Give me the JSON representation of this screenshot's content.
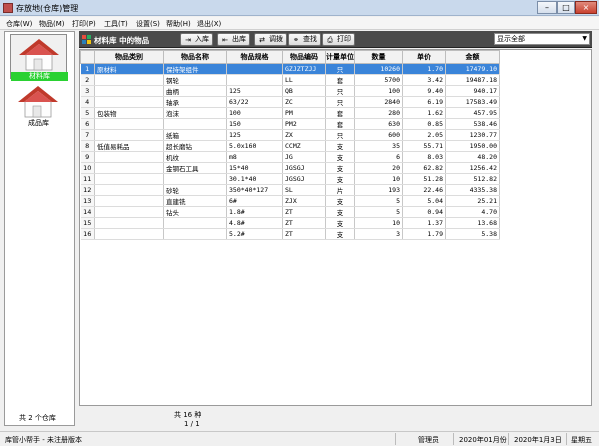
{
  "window": {
    "title": "存放地(仓库)管理"
  },
  "menu": [
    "仓库(W)",
    "物品(M)",
    "打印(P)",
    "工具(T)",
    "设置(S)",
    "帮助(H)",
    "退出(X)"
  ],
  "warehouses": [
    {
      "label": "材料库",
      "selected": true
    },
    {
      "label": "成品库",
      "selected": false
    }
  ],
  "left_status": "共 2 个仓库",
  "toolbar": {
    "title": "材料库 中的物品",
    "buttons": {
      "in": "入库",
      "out": "出库",
      "transfer": "调拨",
      "search": "查找",
      "print": "打印"
    },
    "filter_value": "显示全部"
  },
  "colors": {
    "selected_row": "#3a84d9",
    "warehouse_selected": "#2ad132",
    "roof": "#c0392b"
  },
  "table": {
    "headers": [
      "",
      "物品类别",
      "物品名称",
      "物品规格",
      "物品编码",
      "计量单位",
      "数量",
      "单价",
      "金额"
    ],
    "rows": [
      [
        "1",
        "原材料",
        "保持架组件",
        "",
        "GZJZTZJJ",
        "只",
        "10260",
        "1.70",
        "17479.10"
      ],
      [
        "2",
        "",
        "钢轮",
        "",
        "LL",
        "套",
        "5700",
        "3.42",
        "19487.18"
      ],
      [
        "3",
        "",
        "曲柄",
        "125",
        "QB",
        "只",
        "100",
        "9.40",
        "940.17"
      ],
      [
        "4",
        "",
        "轴承",
        "63/22",
        "ZC",
        "只",
        "2840",
        "6.19",
        "17583.49"
      ],
      [
        "5",
        "包装物",
        "泡沫",
        "100",
        "PM",
        "套",
        "280",
        "1.62",
        "457.95"
      ],
      [
        "6",
        "",
        "",
        "150",
        "PM2",
        "套",
        "630",
        "0.85",
        "538.46"
      ],
      [
        "7",
        "",
        "纸箱",
        "125",
        "ZX",
        "只",
        "600",
        "2.05",
        "1230.77"
      ],
      [
        "8",
        "低值易耗品",
        "超长磨钻",
        "5.0x160",
        "CCMZ",
        "支",
        "35",
        "55.71",
        "1950.00"
      ],
      [
        "9",
        "",
        "机纹",
        "m8",
        "JG",
        "支",
        "6",
        "8.03",
        "48.20"
      ],
      [
        "10",
        "",
        "金钢石工具",
        "15*40",
        "JGSGJ",
        "支",
        "20",
        "62.82",
        "1256.42"
      ],
      [
        "11",
        "",
        "",
        "30.1*40",
        "JGSGJ",
        "支",
        "10",
        "51.28",
        "512.82"
      ],
      [
        "12",
        "",
        "砂轮",
        "350*40*127",
        "SL",
        "片",
        "193",
        "22.46",
        "4335.38"
      ],
      [
        "13",
        "",
        "直建铣",
        "6#",
        "ZJX",
        "支",
        "5",
        "5.04",
        "25.21"
      ],
      [
        "14",
        "",
        "钻头",
        "1.8#",
        "ZT",
        "支",
        "5",
        "0.94",
        "4.70"
      ],
      [
        "15",
        "",
        "",
        "4.8#",
        "ZT",
        "支",
        "10",
        "1.37",
        "13.68"
      ],
      [
        "16",
        "",
        "",
        "5.2#",
        "ZT",
        "支",
        "3",
        "1.79",
        "5.38"
      ]
    ]
  },
  "footer": {
    "count": "共 16 种",
    "page": "1 / 1"
  },
  "status": {
    "app": "库管小帮手 - 未注册版本",
    "user": "管理员",
    "month": "2020年01月份",
    "date": "2020年1月3日",
    "weekday": "星期五"
  }
}
